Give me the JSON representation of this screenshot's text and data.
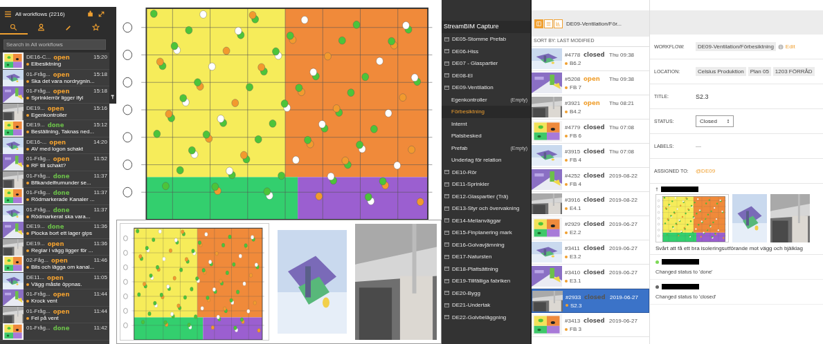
{
  "sidebar": {
    "title": "All workflows (2216)",
    "tabs": [
      {
        "selected": true
      },
      {
        "selected": false
      },
      {
        "selected": false
      },
      {
        "selected": false
      }
    ],
    "search": {
      "placeholder": "Search in All workflows"
    },
    "items": [
      {
        "title": "DE16-C...",
        "status": "open",
        "color": "#f0a030",
        "time": "15:20",
        "subject": "Elbesiktning"
      },
      {
        "title": "01-Fråg...",
        "status": "open",
        "color": "#f0a030",
        "time": "15:18",
        "subject": "Ska det vara nordrygnin..."
      },
      {
        "title": "01-Fråg...",
        "status": "open",
        "color": "#f0a030",
        "time": "15:18",
        "subject": "Sprinklerrör ligger ifyl"
      },
      {
        "title": "DE19...",
        "status": "open",
        "color": "#f0a030",
        "time": "15:16",
        "subject": "Egenkontroller"
      },
      {
        "title": "DE19...",
        "status": "done",
        "color": "#6cc04a",
        "time": "15:12",
        "subject": "Beställning, Taknas ned..."
      },
      {
        "title": "DE16-...",
        "status": "open",
        "color": "#f0a030",
        "time": "14:20",
        "subject": "AV med logon schakt"
      },
      {
        "title": "01-Fråg...",
        "status": "open",
        "color": "#f0a030",
        "time": "11:52",
        "subject": "RF till schakt?"
      },
      {
        "title": "01-Fråg...",
        "status": "done",
        "color": "#6cc04a",
        "time": "11:37",
        "subject": "Bfikandelfrumunder se..."
      },
      {
        "title": "01-Fråg...",
        "status": "done",
        "color": "#6cc04a",
        "time": "11:37",
        "subject": "Rödmarkerade Kanaler ..."
      },
      {
        "title": "01-Fråg...",
        "status": "done",
        "color": "#6cc04a",
        "time": "11:37",
        "subject": "Rödmarkerat ska vara..."
      },
      {
        "title": "DE19...",
        "status": "done",
        "color": "#6cc04a",
        "time": "11:36",
        "subject": "Plocka bort ett lager gips"
      },
      {
        "title": "DE19...",
        "status": "open",
        "color": "#f0a030",
        "time": "11:36",
        "subject": "Reglar i vägg ligger för ..."
      },
      {
        "title": "02-Fåg...",
        "status": "open",
        "color": "#f0a030",
        "time": "11:46",
        "subject": "Bils och lägga om kanal..."
      },
      {
        "title": "DE11...",
        "status": "open",
        "color": "#f0a030",
        "time": "11:05",
        "subject": "Vägg måste öppnas."
      },
      {
        "title": "01-Fråg...",
        "status": "open",
        "color": "#f0a030",
        "time": "11:44",
        "subject": "Krock vent"
      },
      {
        "title": "01-Fråg...",
        "status": "open",
        "color": "#f0a030",
        "time": "11:44",
        "subject": "Fel på vent"
      },
      {
        "title": "01-Fråg...",
        "status": "done",
        "color": "#6cc04a",
        "time": "11:42"
      }
    ]
  },
  "folders": {
    "title": "StreamBIM Capture",
    "items": [
      {
        "label": "DE05-Stomme Prefab",
        "kind": "folder",
        "selected": false
      },
      {
        "label": "DE06-Hiss",
        "kind": "folder",
        "selected": false
      },
      {
        "label": "DE07 - Glaspartier",
        "kind": "folder",
        "selected": false
      },
      {
        "label": "DE08-El",
        "kind": "folder",
        "selected": false
      },
      {
        "label": "DE09-Ventilation",
        "kind": "folder",
        "selected": false
      },
      {
        "label": "Egenkontroller",
        "kind": "sub",
        "note": "(Empty)",
        "selected": false
      },
      {
        "label": "Förbesiktning",
        "kind": "sub",
        "selected": true
      },
      {
        "label": "Internt",
        "kind": "sub",
        "selected": false
      },
      {
        "label": "Platsbesked",
        "kind": "sub",
        "selected": false
      },
      {
        "label": "Prefab",
        "kind": "sub",
        "note": "(Empty)",
        "selected": false
      },
      {
        "label": "Underlag för relation",
        "kind": "sub",
        "selected": false
      },
      {
        "label": "DE10-Rör",
        "kind": "folder",
        "selected": false
      },
      {
        "label": "DE11-Sprinkler",
        "kind": "folder",
        "selected": false
      },
      {
        "label": "DE12-Glaspartier (Trä)",
        "kind": "folder",
        "selected": false
      },
      {
        "label": "DE13-Styr och övervakning",
        "kind": "folder",
        "selected": false
      },
      {
        "label": "DE14-Mellanväggar",
        "kind": "folder",
        "selected": false
      },
      {
        "label": "DE15-Finplanering mark",
        "kind": "folder",
        "selected": false
      },
      {
        "label": "DE16-Golvavjämning",
        "kind": "folder",
        "selected": false
      },
      {
        "label": "DE17-Natursten",
        "kind": "folder",
        "selected": false
      },
      {
        "label": "DE18-Plattsättning",
        "kind": "folder",
        "selected": false
      },
      {
        "label": "DE19-Tillfälliga fabriken",
        "kind": "folder",
        "selected": false
      },
      {
        "label": "DE20-Bygg",
        "kind": "folder",
        "selected": false
      },
      {
        "label": "DE21-Undertak",
        "kind": "folder",
        "selected": false
      },
      {
        "label": "DE22-Golvbeläggning",
        "kind": "folder",
        "selected": false
      }
    ]
  },
  "issues": {
    "views": [
      {
        "selected": true
      },
      {
        "selected": false
      },
      {
        "selected": false
      }
    ],
    "title": "DE09-Ventilation/För...",
    "sort": "SORT BY: LAST MODIFIED",
    "items": [
      {
        "number": "#4778",
        "status": "closed",
        "color": "#555555",
        "date": "Thu 09:38",
        "name": "B6.2",
        "selected": false
      },
      {
        "number": "#5208",
        "status": "open",
        "color": "#f0a030",
        "date": "Thu 09:38",
        "name": "FB 7",
        "selected": false
      },
      {
        "number": "#3921",
        "status": "open",
        "color": "#f0a030",
        "date": "Thu 08:21",
        "name": "B4.2",
        "selected": false
      },
      {
        "number": "#4779",
        "status": "closed",
        "color": "#555555",
        "date": "Thu 07:08",
        "name": "FB 6",
        "selected": false
      },
      {
        "number": "#3915",
        "status": "closed",
        "color": "#555555",
        "date": "Thu 07:08",
        "name": "FB 4",
        "selected": false
      },
      {
        "number": "#4252",
        "status": "closed",
        "color": "#555555",
        "date": "2019-08-22",
        "name": "FB 4",
        "selected": false
      },
      {
        "number": "#3916",
        "status": "closed",
        "color": "#555555",
        "date": "2019-08-22",
        "name": "E4.1",
        "selected": false
      },
      {
        "number": "#2929",
        "status": "closed",
        "color": "#555555",
        "date": "2019-06-27",
        "name": "E2.2",
        "selected": false
      },
      {
        "number": "#3411",
        "status": "closed",
        "color": "#555555",
        "date": "2019-06-27",
        "name": "E3.2",
        "selected": false
      },
      {
        "number": "#3410",
        "status": "closed",
        "color": "#555555",
        "date": "2019-06-27",
        "name": "E3.1",
        "selected": false
      },
      {
        "number": "#2933",
        "status": "closed",
        "color": "#555555",
        "date": "2019-06-27",
        "name": "S2.3",
        "selected": true
      },
      {
        "number": "#3413",
        "status": "closed",
        "color": "#555555",
        "date": "2019-06-27",
        "name": "FB 3",
        "selected": false
      }
    ]
  },
  "detail": {
    "fields": [
      {
        "label": "WORKFLOW:",
        "kind": "workflow",
        "chips": [
          "DE09-Ventilation/Förbesiktning"
        ],
        "link": "Edit"
      },
      {
        "label": "LOCATION:",
        "kind": "chips",
        "chips": [
          "Celsius Produktion",
          "Plan 05",
          "1203 FÖRRÅD"
        ]
      },
      {
        "label": "TITLE:",
        "kind": "text",
        "value": "S2.3"
      },
      {
        "label": "STATUS:",
        "kind": "select",
        "value": "Closed"
      },
      {
        "label": "LABELS:",
        "kind": "muted",
        "value": "—"
      },
      {
        "label": "ASSIGNED TO:",
        "kind": "mention",
        "value": "@DE09"
      }
    ],
    "comment": "Svårt att få ett bra isoleringsutförande mot vägg och bjälklag",
    "activity": [
      {
        "text": "Changed status to 'done'",
        "color": "#7ed957"
      },
      {
        "text": "Changed status to 'closed'",
        "color": "#666666"
      }
    ]
  }
}
